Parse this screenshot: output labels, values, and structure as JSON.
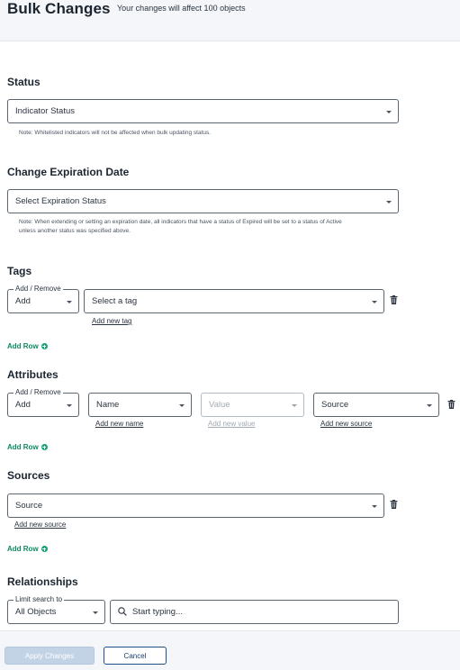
{
  "header": {
    "title": "Bulk Changes",
    "subtitle": "Your changes will affect 100 objects"
  },
  "status": {
    "title": "Status",
    "select_value": "Indicator Status",
    "note": "Note: Whitelisted indicators will not be affected when bulk updating status."
  },
  "expiration": {
    "title": "Change Expiration Date",
    "select_value": "Select Expiration Status",
    "note_line1": "Note: When extending or setting an expiration date, all indicators that have a status of Expired will be set to a status of Active",
    "note_line2": "unless another status was specified above."
  },
  "tags": {
    "title": "Tags",
    "mode_legend": "Add / Remove",
    "mode_value": "Add",
    "tag_placeholder": "Select a tag",
    "add_new_link": "Add new tag",
    "add_row": "Add Row"
  },
  "attributes": {
    "title": "Attributes",
    "mode_legend": "Add / Remove",
    "mode_value": "Add",
    "name_value": "Name",
    "value_value": "Value",
    "source_value": "Source",
    "add_new_name": "Add new name",
    "add_new_value": "Add new value",
    "add_new_source": "Add new source",
    "add_row": "Add Row"
  },
  "sources": {
    "title": "Sources",
    "select_value": "Source",
    "add_new_link": "Add new source",
    "add_row": "Add Row"
  },
  "relationships": {
    "title": "Relationships",
    "limit_legend": "Limit search to",
    "limit_value": "All Objects",
    "search_placeholder": "Start typing..."
  },
  "footer": {
    "apply_label": "Apply Changes",
    "cancel_label": "Cancel"
  },
  "colors": {
    "accent_green": "#16a56f",
    "primary_disabled": "#c3d3e6",
    "cancel_border": "#1f4e8a"
  },
  "icons": [
    "trash-icon",
    "plus-circle-icon",
    "search-icon",
    "caret-down-icon"
  ]
}
